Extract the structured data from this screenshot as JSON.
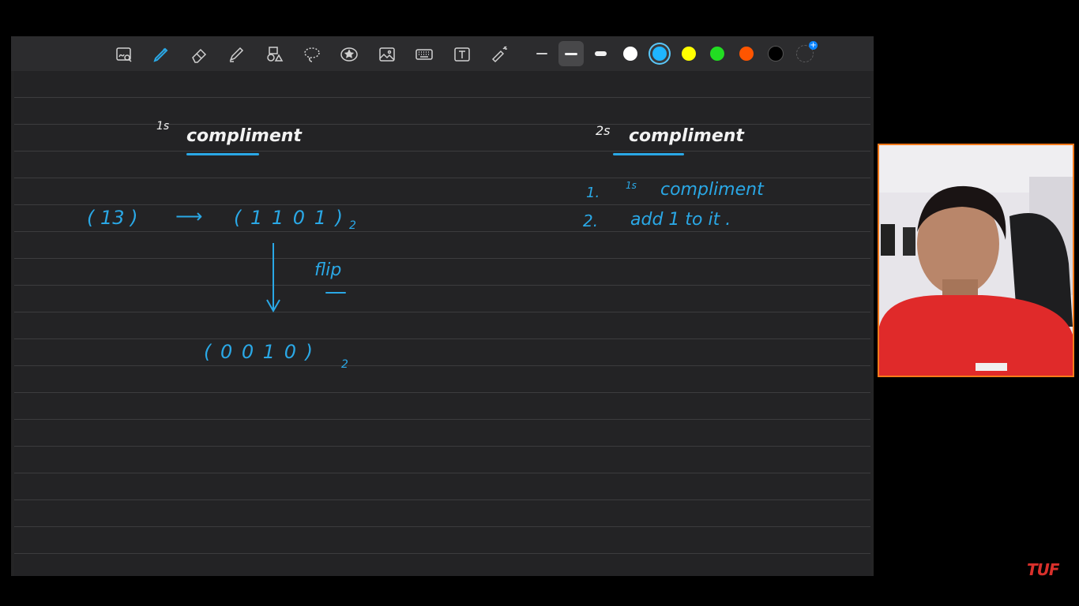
{
  "toolbar": {
    "tools": [
      {
        "name": "zoom-window-icon"
      },
      {
        "name": "pen-icon"
      },
      {
        "name": "eraser-icon"
      },
      {
        "name": "highlighter-icon"
      },
      {
        "name": "shapes-icon"
      },
      {
        "name": "lasso-icon"
      },
      {
        "name": "sticker-icon"
      },
      {
        "name": "image-icon"
      },
      {
        "name": "keyboard-icon"
      },
      {
        "name": "text-box-icon"
      },
      {
        "name": "laser-pointer-icon"
      }
    ],
    "strokes": [
      "thin",
      "medium",
      "thick"
    ],
    "selected_stroke": "medium",
    "colors": [
      "#ffffff",
      "#1fb6ff",
      "#ffff00",
      "#22dd22",
      "#ff5500",
      "#000000"
    ],
    "selected_color": "#1fb6ff"
  },
  "notes": {
    "left_title_sup": "1s",
    "left_title": "compliment",
    "decimal": "( 13 )",
    "arrow": "⟶",
    "binary": "( 1 1 0 1 )",
    "binary_sub": "2",
    "flip": "flip",
    "flipped": "( 0 0 1 0 )",
    "flipped_sub": "2",
    "right_title_sup": "2s",
    "right_title": "compliment",
    "step1_num": "1.",
    "step1_sup": "1s",
    "step1_text": "compliment",
    "step2_num": "2.",
    "step2_text": "add  1  to  it ."
  },
  "brand": {
    "logo": "TUF"
  }
}
